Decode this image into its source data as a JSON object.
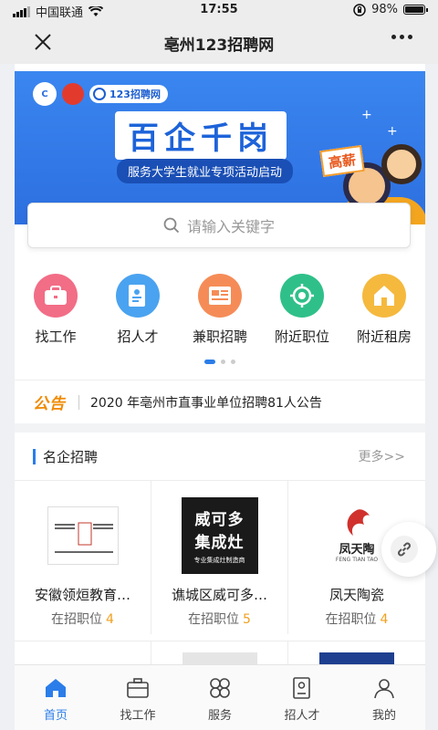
{
  "status_bar": {
    "carrier": "中国联通",
    "time": "17:55",
    "battery": "98%",
    "battery_level": 0.98
  },
  "nav": {
    "title": "亳州123招聘网",
    "close_icon": "close-icon",
    "more_icon": "more-icon"
  },
  "banner": {
    "site_logo_text": "123招聘网",
    "title": "百企千岗",
    "subtitle": "服务大学生就业专项活动启动",
    "badge": "高薪"
  },
  "search": {
    "placeholder": "请输入关键字"
  },
  "quick_menu": [
    {
      "label": "找工作",
      "icon": "briefcase-icon",
      "color": "#f26d86"
    },
    {
      "label": "招人才",
      "icon": "resume-icon",
      "color": "#4aa3f0"
    },
    {
      "label": "兼职招聘",
      "icon": "list-card-icon",
      "color": "#f58c57"
    },
    {
      "label": "附近职位",
      "icon": "target-icon",
      "color": "#2fc089"
    },
    {
      "label": "附近租房",
      "icon": "house-icon",
      "color": "#f5b93e"
    }
  ],
  "carousel": {
    "pages": 3,
    "active": 1
  },
  "notice": {
    "tag": "公告",
    "text": "2020 年亳州市直事业单位招聘81人公告"
  },
  "section": {
    "title": "名企招聘",
    "more": "更多>>"
  },
  "companies": [
    {
      "name": "安徽领烜教育咨询有限公司",
      "name_shown": "安徽领烜教育…",
      "jobs_label": "在招职位",
      "jobs": "4",
      "logo_text": "安徽领烜教育咨询有限公司",
      "logo_mark": "仁领烜义"
    },
    {
      "name": "谯城区威可多集成灶",
      "name_shown": "谯城区威可多…",
      "jobs_label": "在招职位",
      "jobs": "5",
      "logo_line1": "威可多",
      "logo_line2": "集成灶",
      "logo_tag": "专业集成灶制造商"
    },
    {
      "name": "凤天陶瓷",
      "name_shown": "凤天陶瓷",
      "jobs_label": "在招职位",
      "jobs": "4",
      "logo_text": "凤天陶",
      "logo_sub": "FENG TIAN TAO"
    }
  ],
  "tabbar": [
    {
      "label": "首页",
      "icon": "home-icon",
      "active": true
    },
    {
      "label": "找工作",
      "icon": "briefcase-icon",
      "active": false
    },
    {
      "label": "服务",
      "icon": "clover-icon",
      "active": false
    },
    {
      "label": "招人才",
      "icon": "resume-icon",
      "active": false
    },
    {
      "label": "我的",
      "icon": "user-icon",
      "active": false
    }
  ],
  "colors": {
    "accent": "#2b7de9",
    "notice_tag": "#f08a00",
    "job_count": "#f0a020"
  }
}
